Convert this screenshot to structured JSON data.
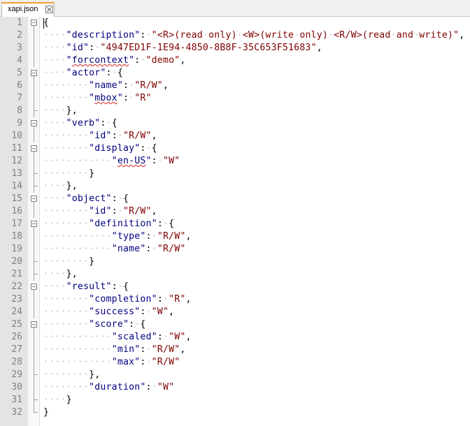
{
  "tab": {
    "filename": "xapi.json"
  },
  "lines": [
    {
      "n": "1",
      "indent": 0,
      "parts": [
        {
          "t": "op",
          "v": "{"
        }
      ]
    },
    {
      "n": "2",
      "indent": 1,
      "parts": [
        {
          "t": "key",
          "v": "\"description\""
        },
        {
          "t": "op",
          "v": ":"
        },
        {
          "t": "str",
          "v": "\"<R>(read only) <W>(write only) <R/W>(read and write)\""
        },
        {
          "t": "op",
          "v": ","
        }
      ]
    },
    {
      "n": "3",
      "indent": 1,
      "parts": [
        {
          "t": "key",
          "v": "\"id\""
        },
        {
          "t": "op",
          "v": ":"
        },
        {
          "t": "str",
          "v": "\"4947ED1F-1E94-4850-8B8F-35C653F51683\""
        },
        {
          "t": "op",
          "v": ","
        }
      ]
    },
    {
      "n": "4",
      "indent": 1,
      "parts": [
        {
          "t": "key",
          "v": "\"forcontext\"",
          "sq": true
        },
        {
          "t": "op",
          "v": ":"
        },
        {
          "t": "str",
          "v": "\"demo\""
        },
        {
          "t": "op",
          "v": ","
        }
      ]
    },
    {
      "n": "5",
      "indent": 1,
      "parts": [
        {
          "t": "key",
          "v": "\"actor\""
        },
        {
          "t": "op",
          "v": ":"
        },
        {
          "t": "op",
          "v": "{"
        }
      ]
    },
    {
      "n": "6",
      "indent": 2,
      "parts": [
        {
          "t": "key",
          "v": "\"name\""
        },
        {
          "t": "op",
          "v": ":"
        },
        {
          "t": "str",
          "v": "\"R/W\""
        },
        {
          "t": "op",
          "v": ","
        }
      ]
    },
    {
      "n": "7",
      "indent": 2,
      "parts": [
        {
          "t": "key",
          "v": "\"mbox\"",
          "sq": true
        },
        {
          "t": "op",
          "v": ":"
        },
        {
          "t": "str",
          "v": "\"R\""
        }
      ]
    },
    {
      "n": "8",
      "indent": 1,
      "parts": [
        {
          "t": "op",
          "v": "},"
        }
      ]
    },
    {
      "n": "9",
      "indent": 1,
      "parts": [
        {
          "t": "key",
          "v": "\"verb\""
        },
        {
          "t": "op",
          "v": ":"
        },
        {
          "t": "op",
          "v": "{"
        }
      ]
    },
    {
      "n": "10",
      "indent": 2,
      "parts": [
        {
          "t": "key",
          "v": "\"id\""
        },
        {
          "t": "op",
          "v": ":"
        },
        {
          "t": "str",
          "v": "\"R/W\""
        },
        {
          "t": "op",
          "v": ","
        }
      ]
    },
    {
      "n": "11",
      "indent": 2,
      "parts": [
        {
          "t": "key",
          "v": "\"display\""
        },
        {
          "t": "op",
          "v": ":"
        },
        {
          "t": "op",
          "v": "{"
        }
      ]
    },
    {
      "n": "12",
      "indent": 3,
      "parts": [
        {
          "t": "key",
          "v": "\"en-US\"",
          "sq": true
        },
        {
          "t": "op",
          "v": ":"
        },
        {
          "t": "str",
          "v": "\"W\""
        }
      ]
    },
    {
      "n": "13",
      "indent": 2,
      "parts": [
        {
          "t": "op",
          "v": "}"
        }
      ]
    },
    {
      "n": "14",
      "indent": 1,
      "parts": [
        {
          "t": "op",
          "v": "},"
        }
      ]
    },
    {
      "n": "15",
      "indent": 1,
      "parts": [
        {
          "t": "key",
          "v": "\"object\""
        },
        {
          "t": "op",
          "v": ":"
        },
        {
          "t": "op",
          "v": "{"
        }
      ]
    },
    {
      "n": "16",
      "indent": 2,
      "parts": [
        {
          "t": "key",
          "v": "\"id\""
        },
        {
          "t": "op",
          "v": ":"
        },
        {
          "t": "str",
          "v": "\"R/W\""
        },
        {
          "t": "op",
          "v": ","
        }
      ]
    },
    {
      "n": "17",
      "indent": 2,
      "parts": [
        {
          "t": "key",
          "v": "\"definition\""
        },
        {
          "t": "op",
          "v": ":"
        },
        {
          "t": "op",
          "v": "{"
        }
      ]
    },
    {
      "n": "18",
      "indent": 3,
      "parts": [
        {
          "t": "key",
          "v": "\"type\""
        },
        {
          "t": "op",
          "v": ":"
        },
        {
          "t": "str",
          "v": "\"R/W\""
        },
        {
          "t": "op",
          "v": ","
        }
      ]
    },
    {
      "n": "19",
      "indent": 3,
      "parts": [
        {
          "t": "key",
          "v": "\"name\""
        },
        {
          "t": "op",
          "v": ":"
        },
        {
          "t": "str",
          "v": "\"R/W\""
        }
      ]
    },
    {
      "n": "20",
      "indent": 2,
      "parts": [
        {
          "t": "op",
          "v": "}"
        }
      ]
    },
    {
      "n": "21",
      "indent": 1,
      "parts": [
        {
          "t": "op",
          "v": "},"
        }
      ]
    },
    {
      "n": "22",
      "indent": 1,
      "parts": [
        {
          "t": "key",
          "v": "\"result\""
        },
        {
          "t": "op",
          "v": ":"
        },
        {
          "t": "op",
          "v": "{"
        }
      ]
    },
    {
      "n": "23",
      "indent": 2,
      "parts": [
        {
          "t": "key",
          "v": "\"completion\""
        },
        {
          "t": "op",
          "v": ":"
        },
        {
          "t": "str",
          "v": "\"R\""
        },
        {
          "t": "op",
          "v": ","
        }
      ]
    },
    {
      "n": "24",
      "indent": 2,
      "parts": [
        {
          "t": "key",
          "v": "\"success\""
        },
        {
          "t": "op",
          "v": ":"
        },
        {
          "t": "str",
          "v": "\"W\""
        },
        {
          "t": "op",
          "v": ","
        }
      ]
    },
    {
      "n": "25",
      "indent": 2,
      "parts": [
        {
          "t": "key",
          "v": "\"score\""
        },
        {
          "t": "op",
          "v": ":"
        },
        {
          "t": "op",
          "v": "{"
        }
      ]
    },
    {
      "n": "26",
      "indent": 3,
      "parts": [
        {
          "t": "key",
          "v": "\"scaled\""
        },
        {
          "t": "op",
          "v": ":"
        },
        {
          "t": "str",
          "v": "\"W\""
        },
        {
          "t": "op",
          "v": ","
        }
      ]
    },
    {
      "n": "27",
      "indent": 3,
      "parts": [
        {
          "t": "key",
          "v": "\"min\""
        },
        {
          "t": "op",
          "v": ":"
        },
        {
          "t": "str",
          "v": "\"R/W\""
        },
        {
          "t": "op",
          "v": ","
        }
      ]
    },
    {
      "n": "28",
      "indent": 3,
      "parts": [
        {
          "t": "key",
          "v": "\"max\""
        },
        {
          "t": "op",
          "v": ":"
        },
        {
          "t": "str",
          "v": "\"R/W\""
        }
      ]
    },
    {
      "n": "29",
      "indent": 2,
      "parts": [
        {
          "t": "op",
          "v": "},"
        }
      ]
    },
    {
      "n": "30",
      "indent": 2,
      "parts": [
        {
          "t": "key",
          "v": "\"duration\""
        },
        {
          "t": "op",
          "v": ":"
        },
        {
          "t": "str",
          "v": "\"W\""
        }
      ]
    },
    {
      "n": "31",
      "indent": 1,
      "parts": [
        {
          "t": "op",
          "v": "}"
        }
      ]
    },
    {
      "n": "32",
      "indent": 0,
      "parts": [
        {
          "t": "op",
          "v": "}"
        }
      ]
    }
  ],
  "folds": {
    "open": [
      "1",
      "5",
      "9",
      "11",
      "15",
      "17",
      "22",
      "25"
    ],
    "close": [
      "8",
      "13",
      "14",
      "20",
      "21",
      "29",
      "31",
      "32"
    ]
  },
  "colors": {
    "key": "#000080",
    "string": "#800000",
    "whitespace_marker": "#c4c4c4",
    "tab_accent": "#f0a030",
    "gutter": "#e4e4e4"
  },
  "icons": {
    "tab_close": "close-icon",
    "fold_open": "fold-minus-icon",
    "fold_end": "fold-end-icon"
  }
}
